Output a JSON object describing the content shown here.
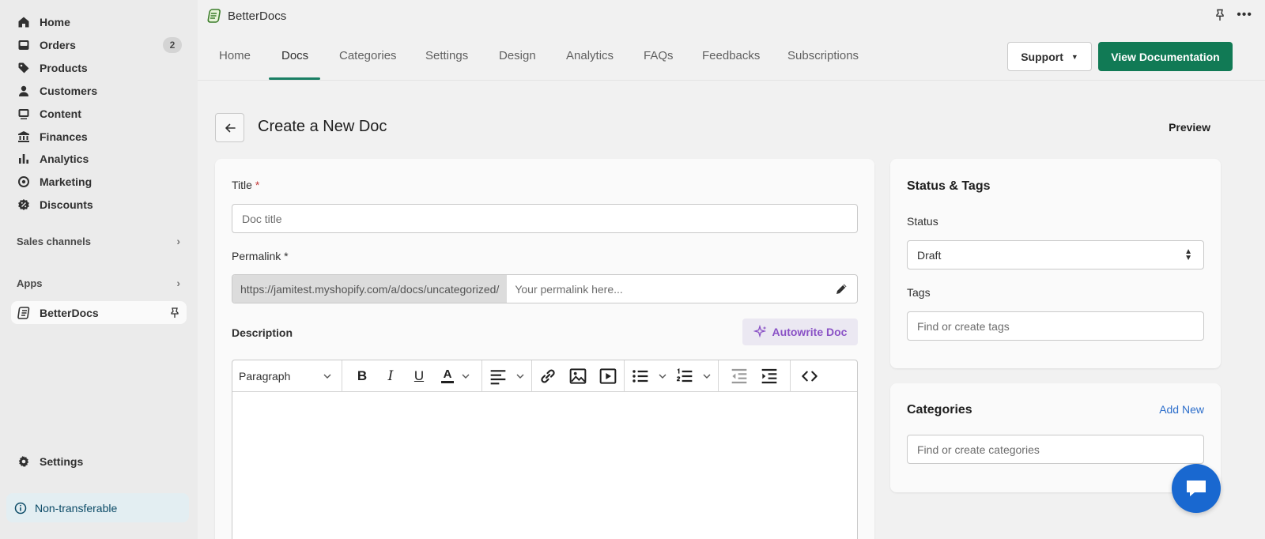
{
  "sidebar": {
    "items": [
      {
        "label": "Home",
        "icon": "home-icon"
      },
      {
        "label": "Orders",
        "icon": "orders-icon",
        "badge": "2"
      },
      {
        "label": "Products",
        "icon": "tag-icon"
      },
      {
        "label": "Customers",
        "icon": "person-icon"
      },
      {
        "label": "Content",
        "icon": "image-icon"
      },
      {
        "label": "Finances",
        "icon": "bank-icon"
      },
      {
        "label": "Analytics",
        "icon": "bar-chart-icon"
      },
      {
        "label": "Marketing",
        "icon": "target-icon"
      },
      {
        "label": "Discounts",
        "icon": "discount-icon"
      }
    ],
    "sales_channels": "Sales channels",
    "apps": "Apps",
    "app_item": "BetterDocs",
    "settings": "Settings",
    "non_transferable": "Non-transferable"
  },
  "app_bar": {
    "name": "BetterDocs"
  },
  "tabs": [
    "Home",
    "Docs",
    "Categories",
    "Settings",
    "Design",
    "Analytics",
    "FAQs",
    "Feedbacks",
    "Subscriptions"
  ],
  "active_tab": "Docs",
  "header": {
    "support_label": "Support",
    "view_doc_label": "View Documentation",
    "page_title": "Create a New Doc",
    "preview_label": "Preview"
  },
  "form": {
    "title_label": "Title",
    "required_mark": "*",
    "title_placeholder": "Doc title",
    "permalink_label": "Permalink",
    "permalink_prefix": "https://jamitest.myshopify.com/a/docs/uncategorized/",
    "permalink_placeholder": "Your permalink here...",
    "description_label": "Description",
    "autowrite_label": "Autowrite Doc",
    "paragraph_label": "Paragraph"
  },
  "status_card": {
    "title": "Status & Tags",
    "status_label": "Status",
    "status_value": "Draft",
    "tags_label": "Tags",
    "tags_placeholder": "Find or create tags"
  },
  "categories_card": {
    "title": "Categories",
    "add_new": "Add New",
    "placeholder": "Find or create categories"
  },
  "colors": {
    "primary": "#117a55",
    "accent_purple": "#8a52c6",
    "link_blue": "#2c6ecb",
    "chat_blue": "#1968d0"
  }
}
